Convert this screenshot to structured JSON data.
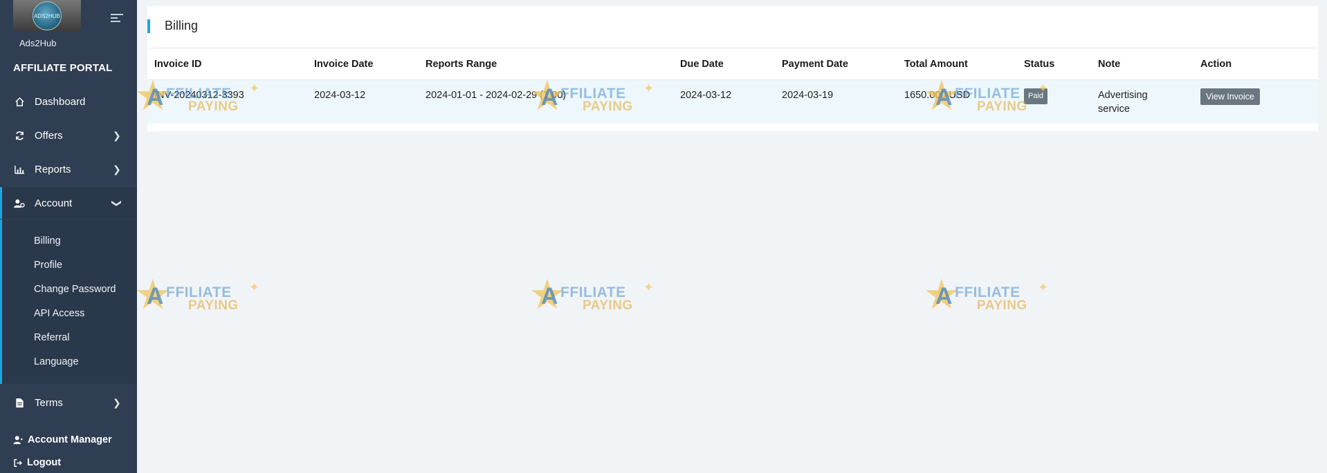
{
  "sidebar": {
    "brand_name": "Ads2Hub",
    "logo_text": "ADS2HUB",
    "portal_title": "AFFILIATE PORTAL",
    "nav": [
      {
        "label": "Dashboard",
        "icon": "home-icon"
      },
      {
        "label": "Offers",
        "icon": "refresh-icon"
      },
      {
        "label": "Reports",
        "icon": "bar-chart-icon"
      },
      {
        "label": "Account",
        "icon": "user-cog-icon"
      },
      {
        "label": "Terms",
        "icon": "file-icon"
      }
    ],
    "account_sub": [
      "Billing",
      "Profile",
      "Change Password",
      "API Access",
      "Referral",
      "Language"
    ],
    "account_manager": "Account Manager",
    "logout": "Logout"
  },
  "page": {
    "title": "Billing"
  },
  "table": {
    "headers": [
      "Invoice ID",
      "Invoice Date",
      "Reports Range",
      "Due Date",
      "Payment Date",
      "Total Amount",
      "Status",
      "Note",
      "Action"
    ],
    "rows": [
      {
        "invoice_id": "INV-20240312-3393",
        "invoice_date": "2024-03-12",
        "reports_range": "2024-01-01 - 2024-02-29 (1.00)",
        "due_date": "2024-03-12",
        "payment_date": "2024-03-19",
        "total_amount": "1650.000 USD",
        "status": "Paid",
        "note": "Advertising service",
        "action": "View Invoice"
      }
    ]
  },
  "watermark": {
    "line1": "FFILIATE",
    "line2": "PAYING",
    "letter": "A"
  },
  "colors": {
    "sidebar_bg": "#2f3e52",
    "accent": "#1ea6e0",
    "badge": "#6a7680"
  }
}
